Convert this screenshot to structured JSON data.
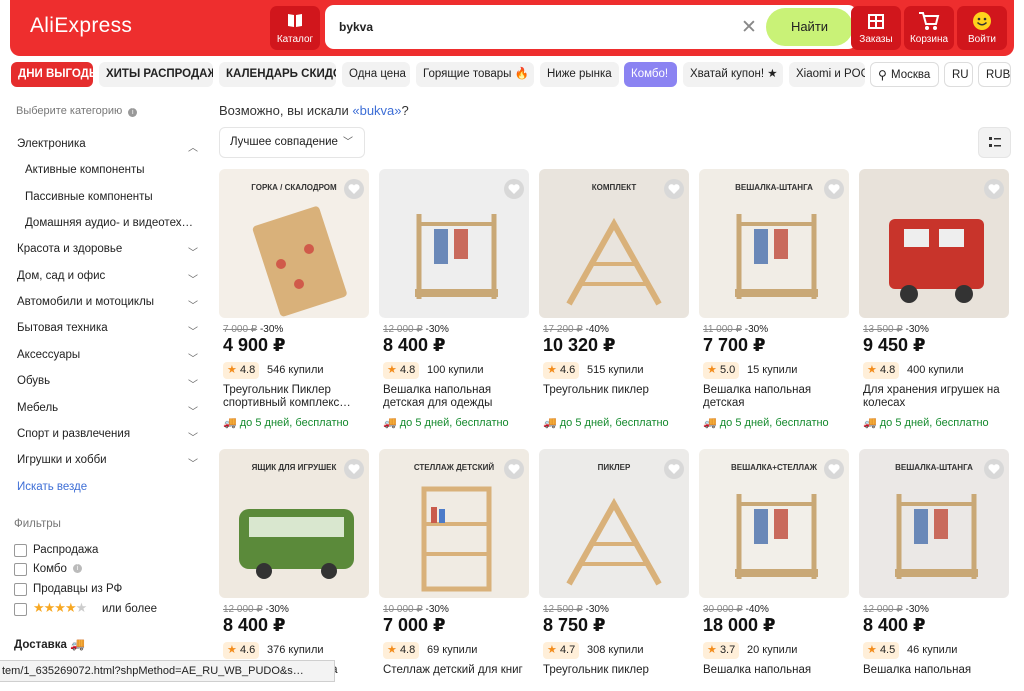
{
  "header": {
    "logo": "AliExpress",
    "catalog_label": "Каталог",
    "search_value": "bykva",
    "find_label": "Найти",
    "orders_label": "Заказы",
    "cart_label": "Корзина",
    "login_label": "Войти"
  },
  "chips": [
    "ДНИ ВЫГОДЫ",
    "ХИТЫ РАСПРОДАЖИ",
    "КАЛЕНДАРЬ СКИДОК",
    "Одна цена",
    "Горящие товары 🔥",
    "Ниже рынка",
    "Комбо!",
    "Хватай купон! ★",
    "Xiaomi и POCO",
    "Москва",
    "RU",
    "RUB"
  ],
  "sidebar": {
    "header": "Выберите категорию",
    "categories": [
      "Электроника",
      "Активные компоненты",
      "Пассивные компоненты",
      "Домашняя аудио- и видеотех…",
      "Красота и здоровье",
      "Дом, сад и офис",
      "Автомобили и мотоциклы",
      "Бытовая техника",
      "Аксессуары",
      "Обувь",
      "Мебель",
      "Спорт и развлечения",
      "Игрушки и хобби"
    ],
    "search_everywhere": "Искать везде",
    "filters_header": "Фильтры",
    "filters": [
      "Распродажа",
      "Комбо",
      "Продавцы из РФ",
      "или более"
    ],
    "delivery_label": "Доставка"
  },
  "main": {
    "did_you_mean_prefix": "Возможно, вы искали ",
    "did_you_mean_link": "«bukva»",
    "did_you_mean_suffix": "?",
    "sort_label": "Лучшее совпадение"
  },
  "products": [
    {
      "old": "7 000 ₽",
      "disc": "-30%",
      "price": "4 900 ₽",
      "rating": "4.8",
      "sold": "546 купили",
      "title": "Треугольник Пиклер спортивный комплекс…",
      "ship": "до 5 дней, бесплатно",
      "img_label": "ГОРКА / СКАЛОДРОМ"
    },
    {
      "old": "12 000 ₽",
      "disc": "-30%",
      "price": "8 400 ₽",
      "rating": "4.8",
      "sold": "100 купили",
      "title": "Вешалка напольная детская для одежды",
      "ship": "до 5 дней, бесплатно",
      "img_label": ""
    },
    {
      "old": "17 200 ₽",
      "disc": "-40%",
      "price": "10 320 ₽",
      "rating": "4.6",
      "sold": "515 купили",
      "title": "Треугольник пиклер",
      "ship": "до 5 дней, бесплатно",
      "img_label": "КОМПЛЕКТ"
    },
    {
      "old": "11 000 ₽",
      "disc": "-30%",
      "price": "7 700 ₽",
      "rating": "5.0",
      "sold": "15 купили",
      "title": "Вешалка напольная детская",
      "ship": "до 5 дней, бесплатно",
      "img_label": "ВЕШАЛКА-ШТАНГА"
    },
    {
      "old": "13 500 ₽",
      "disc": "-30%",
      "price": "9 450 ₽",
      "rating": "4.8",
      "sold": "400 купили",
      "title": "Для хранения игрушек на колесах",
      "ship": "до 5 дней, бесплатно",
      "img_label": ""
    },
    {
      "old": "12 000 ₽",
      "disc": "-30%",
      "price": "8 400 ₽",
      "rating": "4.6",
      "sold": "376 купили",
      "title": "Ящик для игрушек на",
      "ship": "",
      "img_label": "ЯЩИК ДЛЯ ИГРУШЕК"
    },
    {
      "old": "10 000 ₽",
      "disc": "-30%",
      "price": "7 000 ₽",
      "rating": "4.8",
      "sold": "69 купили",
      "title": "Стеллаж детский для книг",
      "ship": "",
      "img_label": "СТЕЛЛАЖ ДЕТСКИЙ"
    },
    {
      "old": "12 500 ₽",
      "disc": "-30%",
      "price": "8 750 ₽",
      "rating": "4.7",
      "sold": "308 купили",
      "title": "Треугольник пиклер",
      "ship": "",
      "img_label": "ПИКЛЕР"
    },
    {
      "old": "30 000 ₽",
      "disc": "-40%",
      "price": "18 000 ₽",
      "rating": "3.7",
      "sold": "20 купили",
      "title": "Вешалка напольная",
      "ship": "",
      "img_label": "ВЕШАЛКА+СТЕЛЛАЖ"
    },
    {
      "old": "12 000 ₽",
      "disc": "-30%",
      "price": "8 400 ₽",
      "rating": "4.5",
      "sold": "46 купили",
      "title": "Вешалка напольная",
      "ship": "",
      "img_label": "ВЕШАЛКА-ШТАНГА"
    }
  ],
  "status_url": "tem/1_635269072.html?shpMethod=AE_RU_WB_PUDO&s…",
  "colors": {
    "brand": "#ee2e2e",
    "find": "#c9f277",
    "combo": "#8b83f2",
    "shipping": "#148a2d",
    "rating_star": "#f28c1c"
  }
}
